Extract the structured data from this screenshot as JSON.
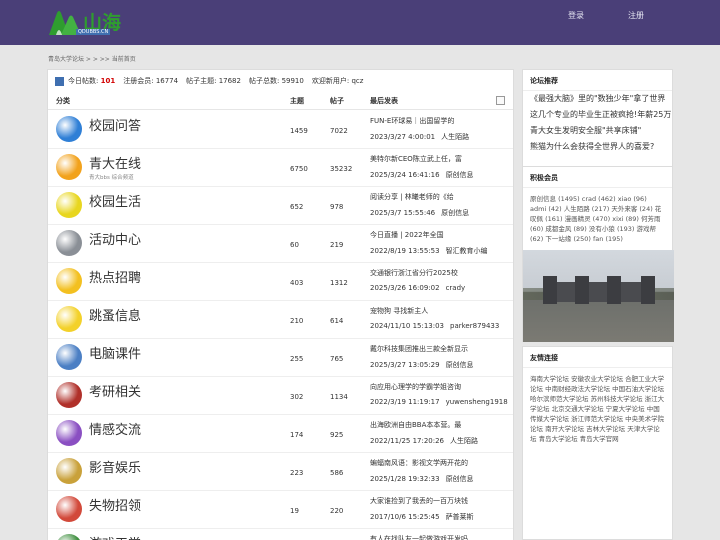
{
  "header": {
    "logo_text": "山海",
    "logo_sub": "QDUBBS.CN",
    "login": "登录",
    "register": "注册"
  },
  "breadcrumb": "青岛大学论坛 > > >> 当前首页",
  "stats": {
    "today_label": "今日帖数:",
    "today": "101",
    "members_label": "注册会员:",
    "members": "16774",
    "topics_label": "帖子主题:",
    "topics": "17682",
    "posts_label": "帖子总数:",
    "posts": "59910",
    "newuser_label": "欢迎新用户:",
    "newuser": "qcz"
  },
  "table_header": {
    "category": "分类",
    "topics": "主题",
    "posts": "帖子",
    "last": "最后发表"
  },
  "forums": [
    {
      "name": "校园问答",
      "sub": "",
      "topics": "1459",
      "posts": "7022",
      "title": "FUN-E环球易｜出国留学的",
      "date": "2023/3/27 4:00:01",
      "author": "人生陌路",
      "icon": "speech-bubble-icon",
      "color": "#2f7fd6"
    },
    {
      "name": "青大在线",
      "sub": "青大bbs 综合频道",
      "topics": "6750",
      "posts": "35232",
      "title": "美特尔新CEO陈立武上任，富",
      "date": "2025/3/24 16:41:16",
      "author": "原创信息",
      "icon": "smiley-icon",
      "color": "#f2a21c"
    },
    {
      "name": "校园生活",
      "sub": "",
      "topics": "652",
      "posts": "978",
      "title": "阅读分享 | 林曦老师的《给",
      "date": "2025/3/7 15:55:46",
      "author": "原创信息",
      "icon": "happy-face-icon",
      "color": "#e8d61f"
    },
    {
      "name": "活动中心",
      "sub": "",
      "topics": "60",
      "posts": "219",
      "title": "今日直播 | 2022年全国",
      "date": "2022/8/19 13:55:53",
      "author": "智汇教育小编",
      "icon": "clock-icon",
      "color": "#8a8f96"
    },
    {
      "name": "热点招聘",
      "sub": "",
      "topics": "403",
      "posts": "1312",
      "title": "交通银行浙江省分行2025校",
      "date": "2025/3/26 16:09:02",
      "author": "crady",
      "icon": "chat-bubble-icon",
      "color": "#f3c020"
    },
    {
      "name": "跳蚤信息",
      "sub": "",
      "topics": "210",
      "posts": "614",
      "title": "宠物狗 寻找新主人",
      "date": "2024/11/10 15:13:03",
      "author": "parker879433",
      "icon": "bee-icon",
      "color": "#f3d12a"
    },
    {
      "name": "电脑课件",
      "sub": "",
      "topics": "255",
      "posts": "765",
      "title": "戴尔科技集团推出三款全新显示",
      "date": "2025/3/27 13:05:29",
      "author": "原创信息",
      "icon": "computer-icon",
      "color": "#4b7fc4"
    },
    {
      "name": "考研相关",
      "sub": "",
      "topics": "302",
      "posts": "1134",
      "title": "向应用心理学的学霸学姐咨询",
      "date": "2022/3/19 11:19:17",
      "author": "yuwensheng1918",
      "icon": "ninja-face-icon",
      "color": "#b0302a"
    },
    {
      "name": "情感交流",
      "sub": "",
      "topics": "174",
      "posts": "925",
      "title": "出海欧洲自由BBA本本营。最",
      "date": "2022/11/25 17:20:26",
      "author": "人生陌路",
      "icon": "flower-icon",
      "color": "#8a4fc2"
    },
    {
      "name": "影音娱乐",
      "sub": "",
      "topics": "223",
      "posts": "586",
      "title": "蝙蝠南风语：影视文学两开花的",
      "date": "2025/1/28 19:32:33",
      "author": "原创信息",
      "icon": "music-note-icon",
      "color": "#c9a13a"
    },
    {
      "name": "失物招领",
      "sub": "",
      "topics": "19",
      "posts": "220",
      "title": "大家谁捡到了我丢的一百万块钱",
      "date": "2017/10/6 15:25:45",
      "author": "萨普莱斯",
      "icon": "balloons-icon",
      "color": "#d2493a"
    },
    {
      "name": "游戏天堂",
      "sub": "",
      "topics": "",
      "posts": "",
      "title": "有人在找队友一起做游戏开发吗",
      "date": "",
      "author": "",
      "icon": "game-icon",
      "color": "#3f8f3f"
    }
  ],
  "sidebar": {
    "recommend_title": "论坛推荐",
    "recommend": [
      "《最强大脑》里的\"数独少年\"拿了世界",
      "这几个专业的毕业生正被疯抢!年薪25万",
      "青大女生发明安全服\"共享床铺\"",
      "熊猫为什么会获得全世界人的喜爱?"
    ],
    "members_title": "积极会员",
    "members_text": "原创信息 (1495) crad (462) xiao (96) admi (42) 人生陌路 (217) 天外来客 (24) 花叹佩 (161) 漫画精灵 (470) xixi (89) 何芳雨 (60) 成都金风 (89) 没有小狼 (193) 游戏帮 (62) 下一站缘 (250) fan (195)",
    "links_title": "友情连接",
    "links_text": "海南大学论坛 安徽农业大学论坛 合肥工业大学论坛 中南财经政法大学论坛 中国石油大学论坛 哈尔滨师范大学论坛 苏州科技大学论坛 浙江大学论坛 北京交通大学论坛 宁夏大学论坛 中国传媒大学论坛 浙江师范大学论坛 中央美术学院论坛 南开大学论坛 吉林大学论坛 天津大学论坛 青岛大学论坛 青岛大学官网"
  },
  "colors": {
    "header_bg": "#4a3f78",
    "accent_red": "#d20000"
  }
}
